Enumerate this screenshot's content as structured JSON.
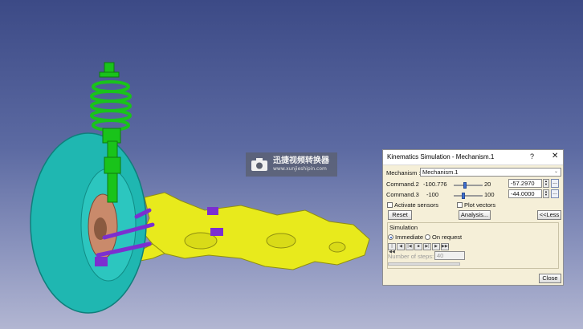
{
  "watermark": {
    "title": "迅捷视频转换器",
    "url": "www.xunjieshipin.com"
  },
  "dialog": {
    "title": "Kinematics Simulation - Mechanism.1",
    "help": "?",
    "close_glyph": "✕",
    "mechanism_label": "Mechanism :",
    "mechanism_value": "Mechanism.1",
    "commands": [
      {
        "label": "Command.2",
        "min": "-100.776",
        "max": "20",
        "value": "-57.2970",
        "slider_fraction": 0.36
      },
      {
        "label": "Command.3",
        "min": "-100",
        "max": "100",
        "value": "-44.0000",
        "slider_fraction": 0.28
      }
    ],
    "activate_sensors": "Activate sensors",
    "plot_vectors": "Plot vectors",
    "reset": "Reset",
    "analysis": "Analysis...",
    "less": "<<Less",
    "simulation_title": "Simulation",
    "immediate": "Immediate",
    "on_request": "On request",
    "player_buttons": [
      "|◀◀",
      "◀",
      "|◀",
      "■",
      "▶|",
      "▶",
      "▶▶|"
    ],
    "steps_label": "Number of steps:",
    "steps_value": "40",
    "close": "Close"
  },
  "colors": {
    "tire": "#1fb7b1",
    "spring": "#19c31a",
    "subframe": "#e8ea1c",
    "arm": "#7b2fd0",
    "background_top": "#3c4a86"
  }
}
